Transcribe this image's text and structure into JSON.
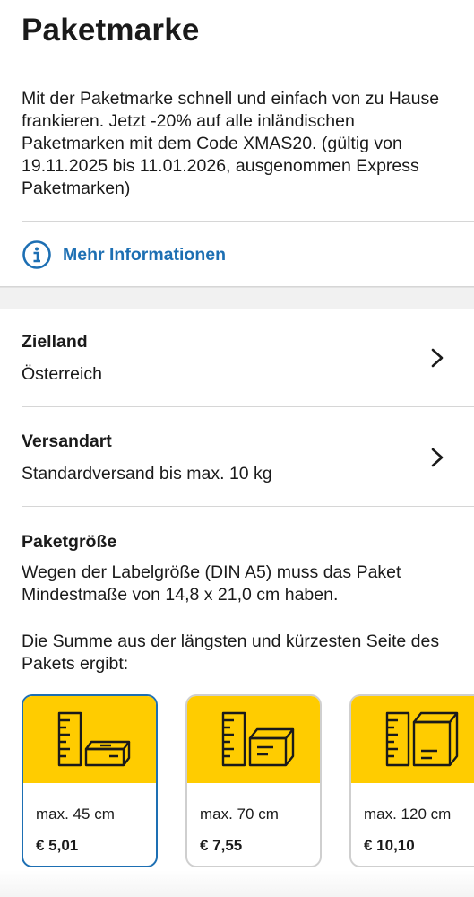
{
  "header": {
    "title": "Paketmarke"
  },
  "intro": "Mit der Paketmarke schnell und einfach von zu Hause frankieren.  Jetzt -20% auf alle inländischen Paketmarken mit dem Code XMAS20. (gültig von 19.11.2025 bis 11.01.2026, ausgenommen Express Paketmarken)",
  "info_link": {
    "label": "Mehr Informationen",
    "icon": "info-icon"
  },
  "destination": {
    "title": "Zielland",
    "value": "Österreich",
    "icon": "chevron-right-icon"
  },
  "shipping": {
    "title": "Versandart",
    "value": "Standardversand bis max. 10 kg",
    "icon": "chevron-right-icon"
  },
  "package_size": {
    "title": "Paketgröße",
    "note": "Wegen der Labelgröße (DIN A5) muss das Paket Mindestmaße von 14,8 x 21,0 cm haben.",
    "sum_note": "Die Summe aus der längsten und kürzesten Seite des Pakets ergibt:",
    "options": [
      {
        "size": "max. 45 cm",
        "price": "€ 5,01",
        "selected": true
      },
      {
        "size": "max. 70 cm",
        "price": "€ 7,55",
        "selected": false
      },
      {
        "size": "max. 120 cm",
        "price": "€ 10,10",
        "selected": false
      }
    ]
  },
  "colors": {
    "accent": "#1d6fb3",
    "card_top": "#ffcc00",
    "divider": "#d6d6d6"
  }
}
